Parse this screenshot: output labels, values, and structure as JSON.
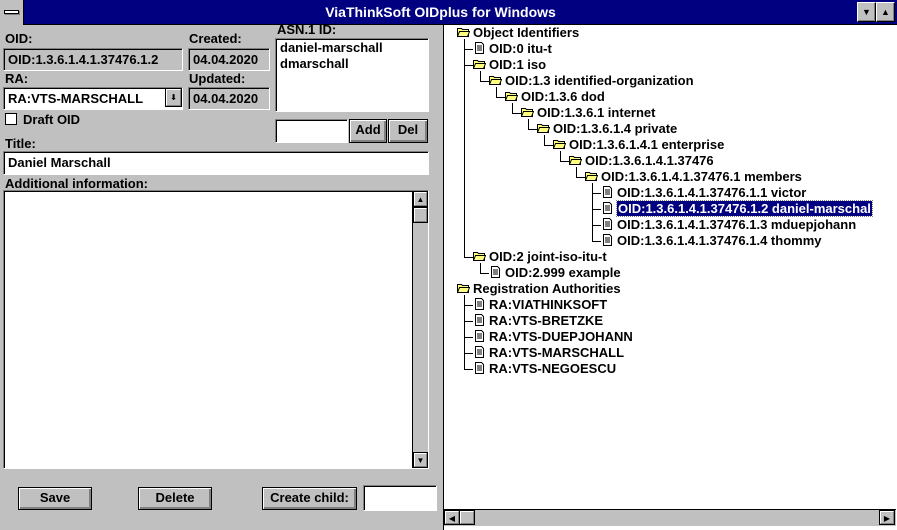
{
  "window": {
    "title": "ViaThinkSoft OIDplus for Windows",
    "minimize_glyph": "▼",
    "maximize_glyph": "▲"
  },
  "form": {
    "oid_label": "OID:",
    "oid_value": "OID:1.3.6.1.4.1.37476.1.2",
    "created_label": "Created:",
    "created_value": "04.04.2020",
    "updated_label": "Updated:",
    "updated_value": "04.04.2020",
    "ra_label": "RA:",
    "ra_value": "RA:VTS-MARSCHALL",
    "draft_label": "Draft OID",
    "asn1_label": "ASN.1 ID:",
    "asn1_ids": [
      "daniel-marschall",
      "dmarschall"
    ],
    "asn1_new_value": "",
    "add_label": "Add",
    "del_label": "Del",
    "title_label": "Title:",
    "title_value": "Daniel Marschall",
    "additional_label": "Additional information:",
    "additional_value": "",
    "save_label": "Save",
    "delete_label": "Delete",
    "create_child_label": "Create child:",
    "create_child_value": ""
  },
  "tree": {
    "nodes": [
      {
        "label": "Object Identifiers",
        "type": "folder"
      },
      {
        "label": "OID:0 itu-t",
        "type": "doc"
      },
      {
        "label": "OID:1 iso",
        "type": "folder"
      },
      {
        "label": "OID:1.3 identified-organization",
        "type": "folder"
      },
      {
        "label": "OID:1.3.6 dod",
        "type": "folder"
      },
      {
        "label": "OID:1.3.6.1 internet",
        "type": "folder"
      },
      {
        "label": "OID:1.3.6.1.4 private",
        "type": "folder"
      },
      {
        "label": "OID:1.3.6.1.4.1 enterprise",
        "type": "folder"
      },
      {
        "label": "OID:1.3.6.1.4.1.37476",
        "type": "folder"
      },
      {
        "label": "OID:1.3.6.1.4.1.37476.1 members",
        "type": "folder"
      },
      {
        "label": "OID:1.3.6.1.4.1.37476.1.1 victor",
        "type": "doc"
      },
      {
        "label": "OID:1.3.6.1.4.1.37476.1.2 daniel-marschal",
        "type": "doc",
        "selected": true
      },
      {
        "label": "OID:1.3.6.1.4.1.37476.1.3 mduepjohann",
        "type": "doc"
      },
      {
        "label": "OID:1.3.6.1.4.1.37476.1.4 thommy",
        "type": "doc"
      },
      {
        "label": "OID:2 joint-iso-itu-t",
        "type": "folder"
      },
      {
        "label": "OID:2.999 example",
        "type": "doc"
      },
      {
        "label": "Registration Authorities",
        "type": "folder"
      },
      {
        "label": "RA:VIATHINKSOFT",
        "type": "doc"
      },
      {
        "label": "RA:VTS-BRETZKE",
        "type": "doc"
      },
      {
        "label": "RA:VTS-DUEPJOHANN",
        "type": "doc"
      },
      {
        "label": "RA:VTS-MARSCHALL",
        "type": "doc"
      },
      {
        "label": "RA:VTS-NEGOESCU",
        "type": "doc"
      }
    ]
  },
  "colors": {
    "titlebar": "#000080",
    "face": "#c0c0c0",
    "selection": "#000080"
  }
}
